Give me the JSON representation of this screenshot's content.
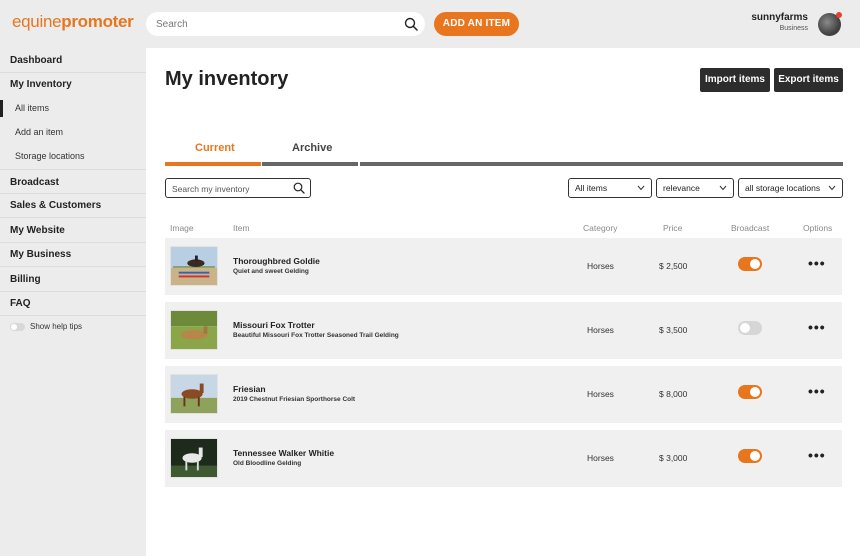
{
  "brand": {
    "logo_part1": "equine",
    "logo_part2": "pr",
    "logo_part3": "o",
    "logo_part4": "moter",
    "accent_color": "#e8761e"
  },
  "header": {
    "search_placeholder": "Search",
    "add_item_label": "ADD AN ITEM",
    "user_name": "sunnyfarms",
    "user_role": "Business"
  },
  "sidebar": {
    "items": [
      {
        "label": "Dashboard"
      },
      {
        "label": "My Inventory"
      },
      {
        "label": "Broadcast"
      },
      {
        "label": "Sales & Customers"
      },
      {
        "label": "My Website"
      },
      {
        "label": "My Business"
      },
      {
        "label": "Billing"
      },
      {
        "label": "FAQ"
      }
    ],
    "sub_items": [
      {
        "label": "All items",
        "active": true
      },
      {
        "label": "Add an item"
      },
      {
        "label": "Storage locations"
      }
    ],
    "help_tips_label": "Show help tips"
  },
  "main": {
    "title": "My inventory",
    "import_label": "Import items",
    "export_label": "Export items",
    "tabs": [
      {
        "label": "Current",
        "active": true
      },
      {
        "label": "Archive"
      }
    ],
    "inventory_search_placeholder": "Search my inventory",
    "filters": {
      "type": "All items",
      "sort": "relevance",
      "location": "all storage locations"
    },
    "columns": [
      "Image",
      "Item",
      "Category",
      "Price",
      "Broadcast",
      "Options"
    ],
    "rows": [
      {
        "name": "Thoroughbred    Goldie",
        "desc": "Quiet and sweet Gelding",
        "category": "Horses",
        "price": "$ 2,500",
        "broadcast": true,
        "thumb_icon": "jumping-horse-photo"
      },
      {
        "name": "Missouri Fox Trotter",
        "desc": "Beautiful Missouri Fox Trotter Seasoned Trail Gelding",
        "category": "Horses",
        "price": "$ 3,500",
        "broadcast": false,
        "thumb_icon": "lying-horse-photo"
      },
      {
        "name": "Friesian",
        "desc": "2019 Chestnut Friesian Sporthorse Colt",
        "category": "Horses",
        "price": "$ 8,000",
        "broadcast": true,
        "thumb_icon": "chestnut-horse-photo"
      },
      {
        "name": "Tennessee Walker    Whitie",
        "desc": "Old Bloodline Gelding",
        "category": "Horses",
        "price": "$ 3,000",
        "broadcast": true,
        "thumb_icon": "white-horse-photo"
      }
    ],
    "options_glyph": "•••"
  }
}
